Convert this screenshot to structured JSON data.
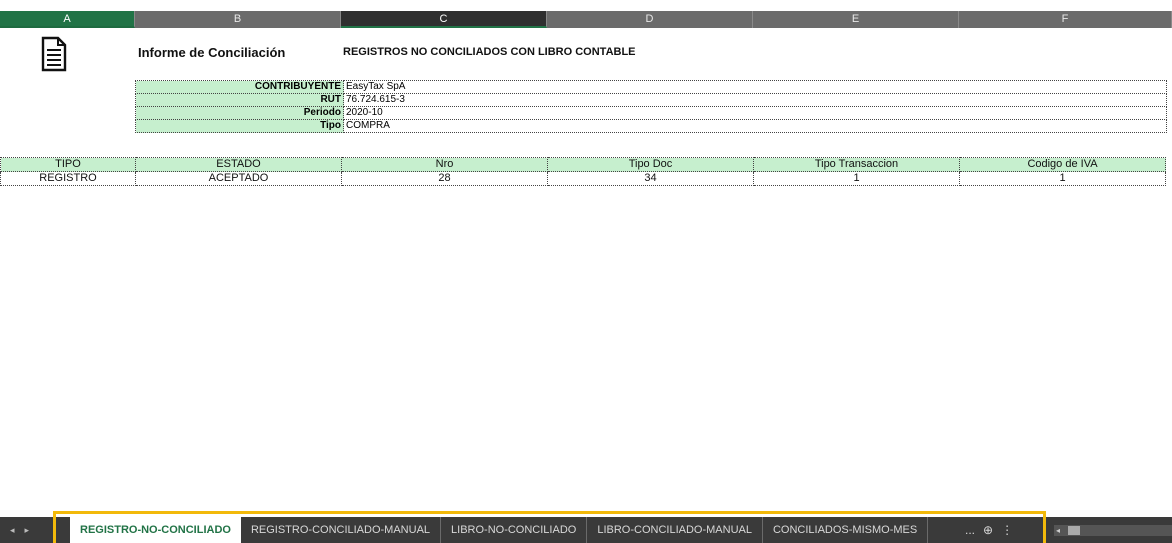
{
  "columns": [
    "A",
    "B",
    "C",
    "D",
    "E",
    "F"
  ],
  "report": {
    "title": "Informe de Conciliación",
    "subtitle": "REGISTROS NO CONCILIADOS CON LIBRO CONTABLE"
  },
  "info": [
    {
      "key": "CONTRIBUYENTE",
      "value": "EasyTax SpA"
    },
    {
      "key": "RUT",
      "value": "76.724.615-3"
    },
    {
      "key": "Periodo",
      "value": "2020-10"
    },
    {
      "key": "Tipo",
      "value": "COMPRA"
    }
  ],
  "table": {
    "headers": [
      "TIPO",
      "ESTADO",
      "Nro",
      "Tipo Doc",
      "Tipo Transaccion",
      "Codigo de IVA"
    ],
    "rows": [
      [
        "REGISTRO",
        "ACEPTADO",
        "28",
        "34",
        "1",
        "1"
      ]
    ]
  },
  "sheet_tabs": [
    "REGISTRO-NO-CONCILIADO",
    "REGISTRO-CONCILIADO-MANUAL",
    "LIBRO-NO-CONCILIADO",
    "LIBRO-CONCILIADO-MANUAL",
    "CONCILIADOS-MISMO-MES"
  ],
  "active_tab": "REGISTRO-NO-CONCILIADO",
  "tab_more": "...",
  "add_sheet_icon": "plus-circle-icon",
  "colors": {
    "header_fill": "#c6efce",
    "active_tab_text": "#217346",
    "highlight_border": "#f2b90b"
  }
}
